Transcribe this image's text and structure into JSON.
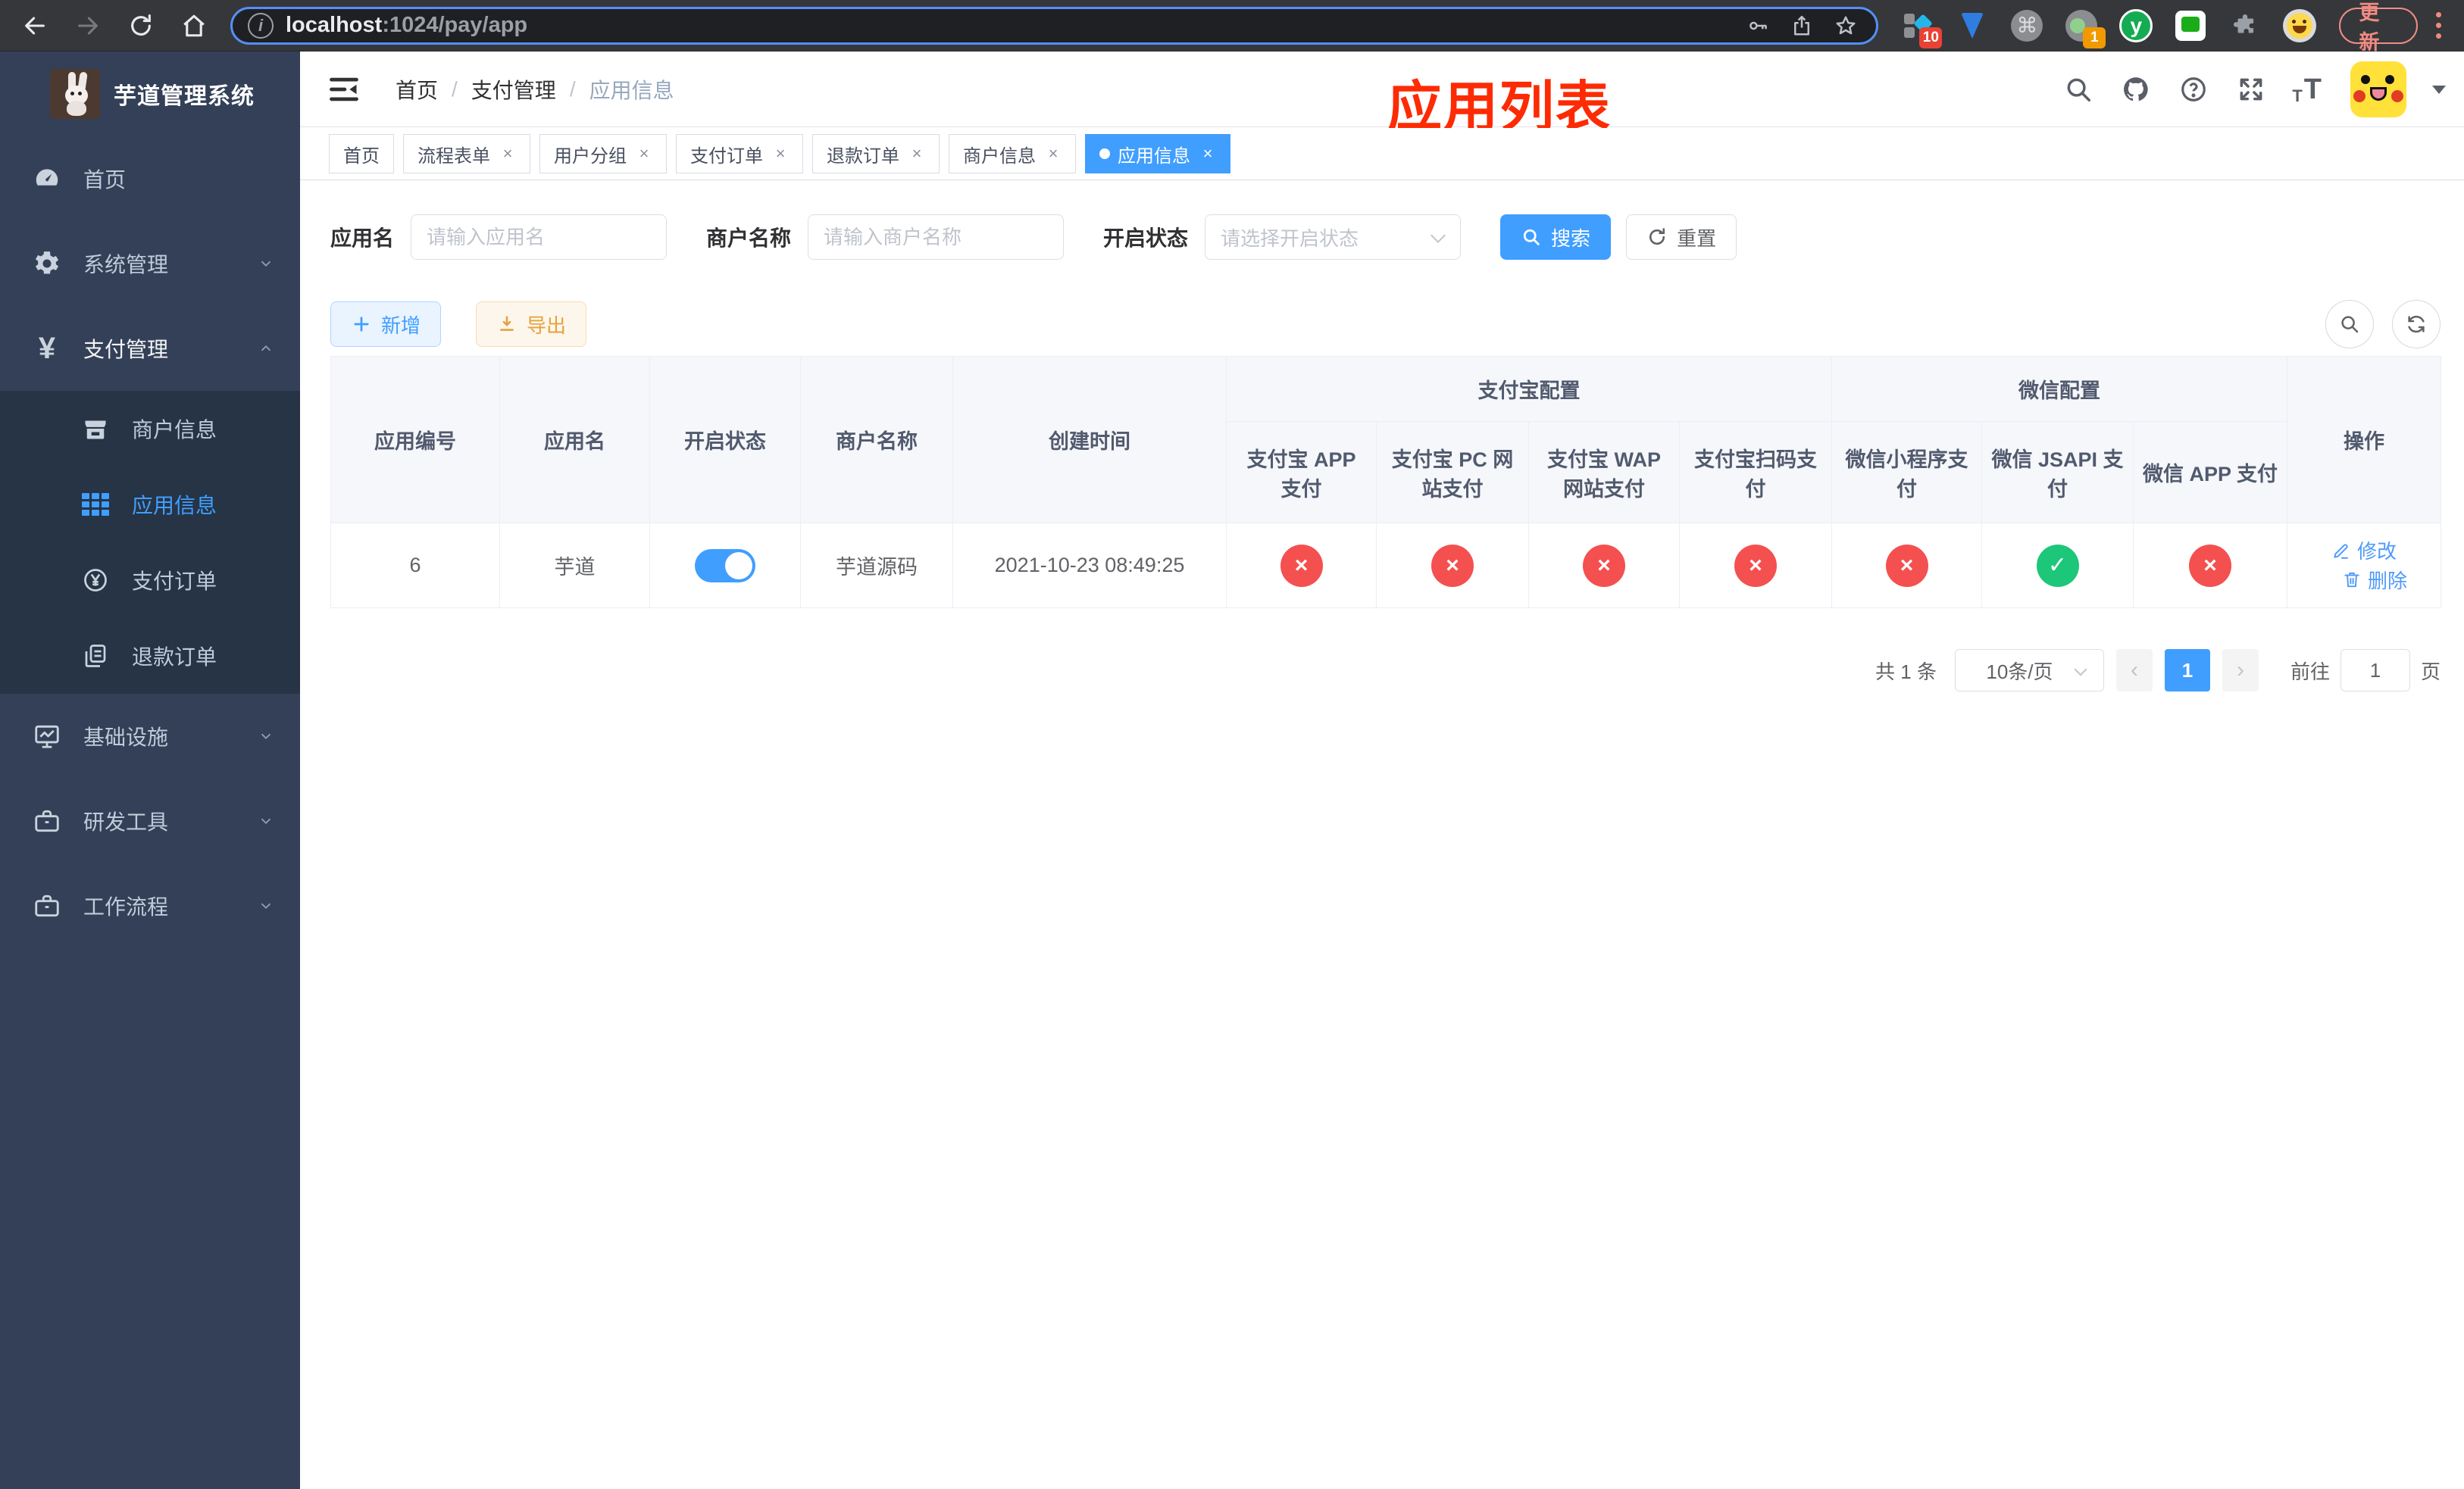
{
  "browser": {
    "url_host": "localhost",
    "url_rest": ":1024/pay/app",
    "update_label": "更新",
    "ext_badge_blocks": "10",
    "ext_badge_lens": "1",
    "ext_y_letter": "y",
    "ext_command_glyph": "⌘"
  },
  "sidebar": {
    "title": "芋道管理系统",
    "items": [
      {
        "label": "首页"
      },
      {
        "label": "系统管理"
      },
      {
        "label": "支付管理"
      },
      {
        "label": "基础设施"
      },
      {
        "label": "研发工具"
      },
      {
        "label": "工作流程"
      }
    ],
    "submenu": [
      {
        "label": "商户信息"
      },
      {
        "label": "应用信息"
      },
      {
        "label": "支付订单"
      },
      {
        "label": "退款订单"
      }
    ]
  },
  "breadcrumb": {
    "home": "首页",
    "section": "支付管理",
    "current": "应用信息"
  },
  "annotation": {
    "title": "应用列表",
    "color": "#fd2b03"
  },
  "tabs": [
    {
      "label": "首页"
    },
    {
      "label": "流程表单"
    },
    {
      "label": "用户分组"
    },
    {
      "label": "支付订单"
    },
    {
      "label": "退款订单"
    },
    {
      "label": "商户信息"
    },
    {
      "label": "应用信息"
    }
  ],
  "filters": {
    "app_name_label": "应用名",
    "app_name_placeholder": "请输入应用名",
    "merchant_label": "商户名称",
    "merchant_placeholder": "请输入商户名称",
    "status_label": "开启状态",
    "status_placeholder": "请选择开启状态",
    "search_label": "搜索",
    "reset_label": "重置"
  },
  "toolbar": {
    "add_label": "新增",
    "export_label": "导出"
  },
  "table": {
    "headers": {
      "app_id": "应用编号",
      "app_name": "应用名",
      "status": "开启状态",
      "merchant": "商户名称",
      "created": "创建时间",
      "actions": "操作"
    },
    "group_headers": {
      "alipay": "支付宝配置",
      "wechat": "微信配置"
    },
    "sub_headers": [
      "支付宝 APP 支付",
      "支付宝 PC 网站支付",
      "支付宝 WAP 网站支付",
      "支付宝扫码支付",
      "微信小程序支付",
      "微信 JSAPI 支付",
      "微信 APP 支付"
    ],
    "status_colors": {
      "fail": "#f4504f",
      "success": "#1dc779"
    },
    "rows": [
      {
        "app_id": "6",
        "app_name": "芋道",
        "enabled_state": "on",
        "merchant": "芋道源码",
        "created": "2021-10-23 08:49:25",
        "pay_status": [
          {
            "state": "fail",
            "glyph": "×"
          },
          {
            "state": "fail",
            "glyph": "×"
          },
          {
            "state": "fail",
            "glyph": "×"
          },
          {
            "state": "fail",
            "glyph": "×"
          },
          {
            "state": "fail",
            "glyph": "×"
          },
          {
            "state": "success",
            "glyph": "✓"
          },
          {
            "state": "fail",
            "glyph": "×"
          }
        ],
        "edit_label": "修改",
        "delete_label": "删除"
      }
    ]
  },
  "pagination": {
    "total": "共 1 条",
    "page_size": "10条/页",
    "current_page": "1",
    "goto_label": "前往",
    "goto_value": "1",
    "page_unit": "页"
  }
}
